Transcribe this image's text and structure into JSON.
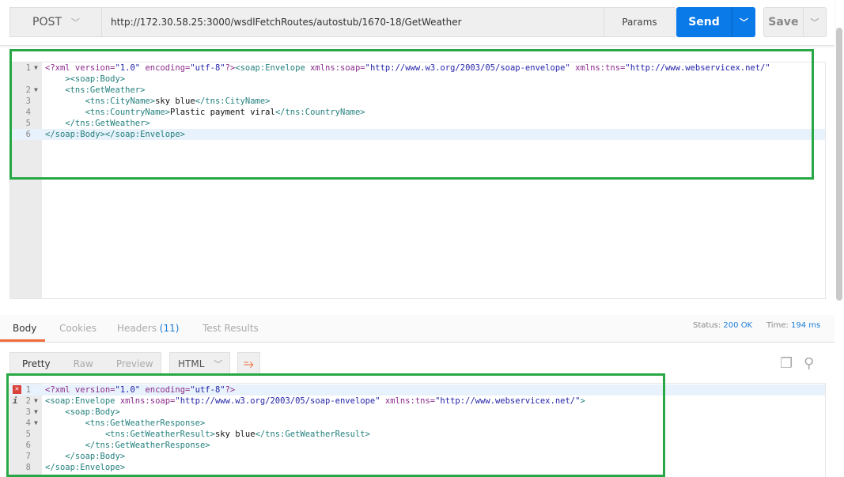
{
  "request": {
    "method": "POST",
    "url": "http://172.30.58.25:3000/wsdlFetchRoutes/autostub/1670-18/GetWeather",
    "params_label": "Params",
    "send_label": "Send",
    "save_label": "Save",
    "lines": [
      {
        "n": "1",
        "fold": true,
        "tokens": [
          [
            "attr",
            "<?xml version="
          ],
          [
            "str",
            "\"1.0\""
          ],
          [
            "attr",
            " encoding="
          ],
          [
            "str",
            "\"utf-8\""
          ],
          [
            "attr",
            "?>"
          ],
          [
            "tag",
            "<soap:Envelope "
          ],
          [
            "attr",
            "xmlns:soap="
          ],
          [
            "str",
            "\"http://www.w3.org/2003/05/soap-envelope\""
          ],
          [
            "attr",
            " xmlns:tns="
          ],
          [
            "str",
            "\"http://www.webservicex.net/\""
          ]
        ]
      },
      {
        "n": "",
        "fold": false,
        "tokens": [
          [
            "tag",
            "    ><soap:Body>"
          ]
        ]
      },
      {
        "n": "2",
        "fold": true,
        "tokens": [
          [
            "tag",
            "    <tns:GetWeather>"
          ]
        ]
      },
      {
        "n": "3",
        "fold": false,
        "tokens": [
          [
            "tag",
            "        <tns:CityName>"
          ],
          [
            "text",
            "sky blue"
          ],
          [
            "tag",
            "</tns:CityName>"
          ]
        ]
      },
      {
        "n": "4",
        "fold": false,
        "tokens": [
          [
            "tag",
            "        <tns:CountryName>"
          ],
          [
            "text",
            "Plastic payment viral"
          ],
          [
            "tag",
            "</tns:CountryName>"
          ]
        ]
      },
      {
        "n": "5",
        "fold": false,
        "tokens": [
          [
            "tag",
            "    </tns:GetWeather>"
          ]
        ]
      },
      {
        "n": "6",
        "fold": false,
        "active": true,
        "tokens": [
          [
            "tag",
            "</soap:Body></soap:Envelope>"
          ]
        ]
      }
    ]
  },
  "response": {
    "tabs": {
      "body": "Body",
      "cookies": "Cookies",
      "headers": "Headers",
      "headers_count": "(11)",
      "tests": "Test Results"
    },
    "status_label": "Status:",
    "status_value": "200 OK",
    "time_label": "Time:",
    "time_value": "194 ms",
    "views": {
      "pretty": "Pretty",
      "raw": "Raw",
      "preview": "Preview"
    },
    "format": "HTML",
    "lines": [
      {
        "n": "1",
        "fold": false,
        "marker": "error",
        "active": true,
        "tokens": [
          [
            "attr",
            "<?xml version="
          ],
          [
            "str",
            "\"1.0\""
          ],
          [
            "attr",
            " encoding="
          ],
          [
            "str",
            "\"utf-8\""
          ],
          [
            "attr",
            "?>"
          ]
        ]
      },
      {
        "n": "2",
        "fold": true,
        "marker": "info",
        "tokens": [
          [
            "tag",
            "<soap:Envelope "
          ],
          [
            "attr",
            "xmlns:soap="
          ],
          [
            "str",
            "\"http://www.w3.org/2003/05/soap-envelope\""
          ],
          [
            "attr",
            " xmlns:tns="
          ],
          [
            "str",
            "\"http://www.webservicex.net/\""
          ],
          [
            "tag",
            ">"
          ]
        ]
      },
      {
        "n": "3",
        "fold": true,
        "tokens": [
          [
            "tag",
            "    <soap:Body>"
          ]
        ]
      },
      {
        "n": "4",
        "fold": true,
        "tokens": [
          [
            "tag",
            "        <tns:GetWeatherResponse>"
          ]
        ]
      },
      {
        "n": "5",
        "fold": false,
        "tokens": [
          [
            "tag",
            "            <tns:GetWeatherResult>"
          ],
          [
            "text",
            "sky blue"
          ],
          [
            "tag",
            "</tns:GetWeatherResult>"
          ]
        ]
      },
      {
        "n": "6",
        "fold": false,
        "tokens": [
          [
            "tag",
            "        </tns:GetWeatherResponse>"
          ]
        ]
      },
      {
        "n": "7",
        "fold": false,
        "tokens": [
          [
            "tag",
            "    </soap:Body>"
          ]
        ]
      },
      {
        "n": "8",
        "fold": false,
        "tokens": [
          [
            "tag",
            "</soap:Envelope>"
          ]
        ]
      }
    ]
  }
}
